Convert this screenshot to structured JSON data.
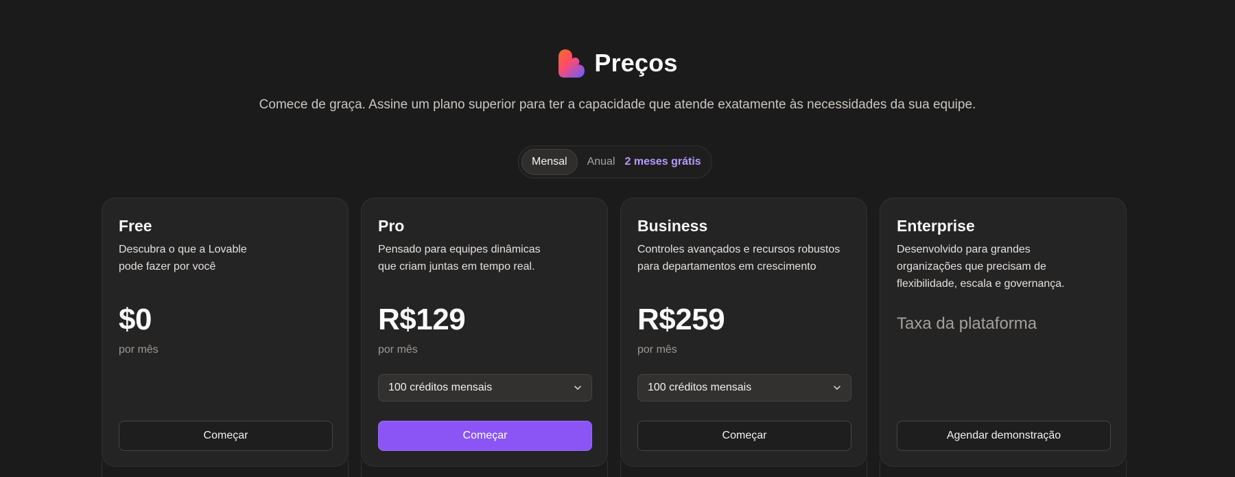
{
  "header": {
    "title": "Preços",
    "subtitle": "Comece de graça. Assine um plano superior para ter a capacidade que atende exatamente às necessidades da sua equipe."
  },
  "billing_toggle": {
    "monthly_label": "Mensal",
    "annual_label": "Anual",
    "annual_badge": "2 meses grátis",
    "selected": "Mensal"
  },
  "colors": {
    "background": "#1c1b1b",
    "card": "#252424",
    "accent": "#8b55f6",
    "badge": "#b49cff"
  },
  "plans": [
    {
      "name": "Free",
      "description": "Descubra o que a Lovable pode fazer por você",
      "price": "$0",
      "period": "por mês",
      "button": "Começar"
    },
    {
      "name": "Pro",
      "description": "Pensado para equipes dinâmicas que criam juntas em tempo real.",
      "price": "R$129",
      "period": "por mês",
      "credits_select": "100 créditos mensais",
      "button": "Começar"
    },
    {
      "name": "Business",
      "description": "Controles avançados e recursos robustos para departamentos em crescimento",
      "price": "R$259",
      "period": "por mês",
      "credits_select": "100 créditos mensais",
      "button": "Começar"
    },
    {
      "name": "Enterprise",
      "description": "Desenvolvido para grandes organizações que precisam de flexibilidade, escala e governança.",
      "price_note": "Taxa da plataforma",
      "button": "Agendar demonstração"
    }
  ]
}
